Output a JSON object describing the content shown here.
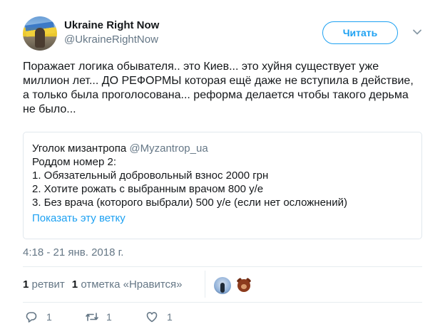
{
  "author": {
    "name": "Ukraine Right Now",
    "handle": "@UkraineRightNow"
  },
  "follow_label": "Читать",
  "tweet_text": "Поражает логика обывателя.. это Киев... это хуйня существует уже миллион лет... ДО РЕФОРМЫ которая ещё даже не вступила в действие, а только была проголосована... реформа делается чтобы такого дерьма не было...",
  "quote": {
    "author": "Уголок мизантропа",
    "handle": "@Myzantrop_ua",
    "lines": [
      "Роддом номер 2:",
      "1. Обязательный добровольный взнос 2000 грн",
      "2. Хотите рожать с выбранным врачом 800 у/е",
      "3. Без врача (которого выбрали) 500 у/е (если нет осложнений)"
    ],
    "show_thread": "Показать эту ветку"
  },
  "timestamp": "4:18 - 21 янв. 2018 г.",
  "stats": {
    "retweets_count": "1",
    "retweets_label": "ретвит",
    "likes_count": "1",
    "likes_label": "отметка «Нравится»"
  },
  "actions": {
    "reply_count": "1",
    "retweet_count": "1",
    "like_count": "1"
  },
  "icons": {
    "reply": "reply-icon",
    "retweet": "retweet-icon",
    "like": "heart-icon",
    "more": "chevron-down-icon"
  },
  "colors": {
    "accent": "#1da1f2",
    "secondary_text": "#657786",
    "border": "#e1e8ed"
  }
}
